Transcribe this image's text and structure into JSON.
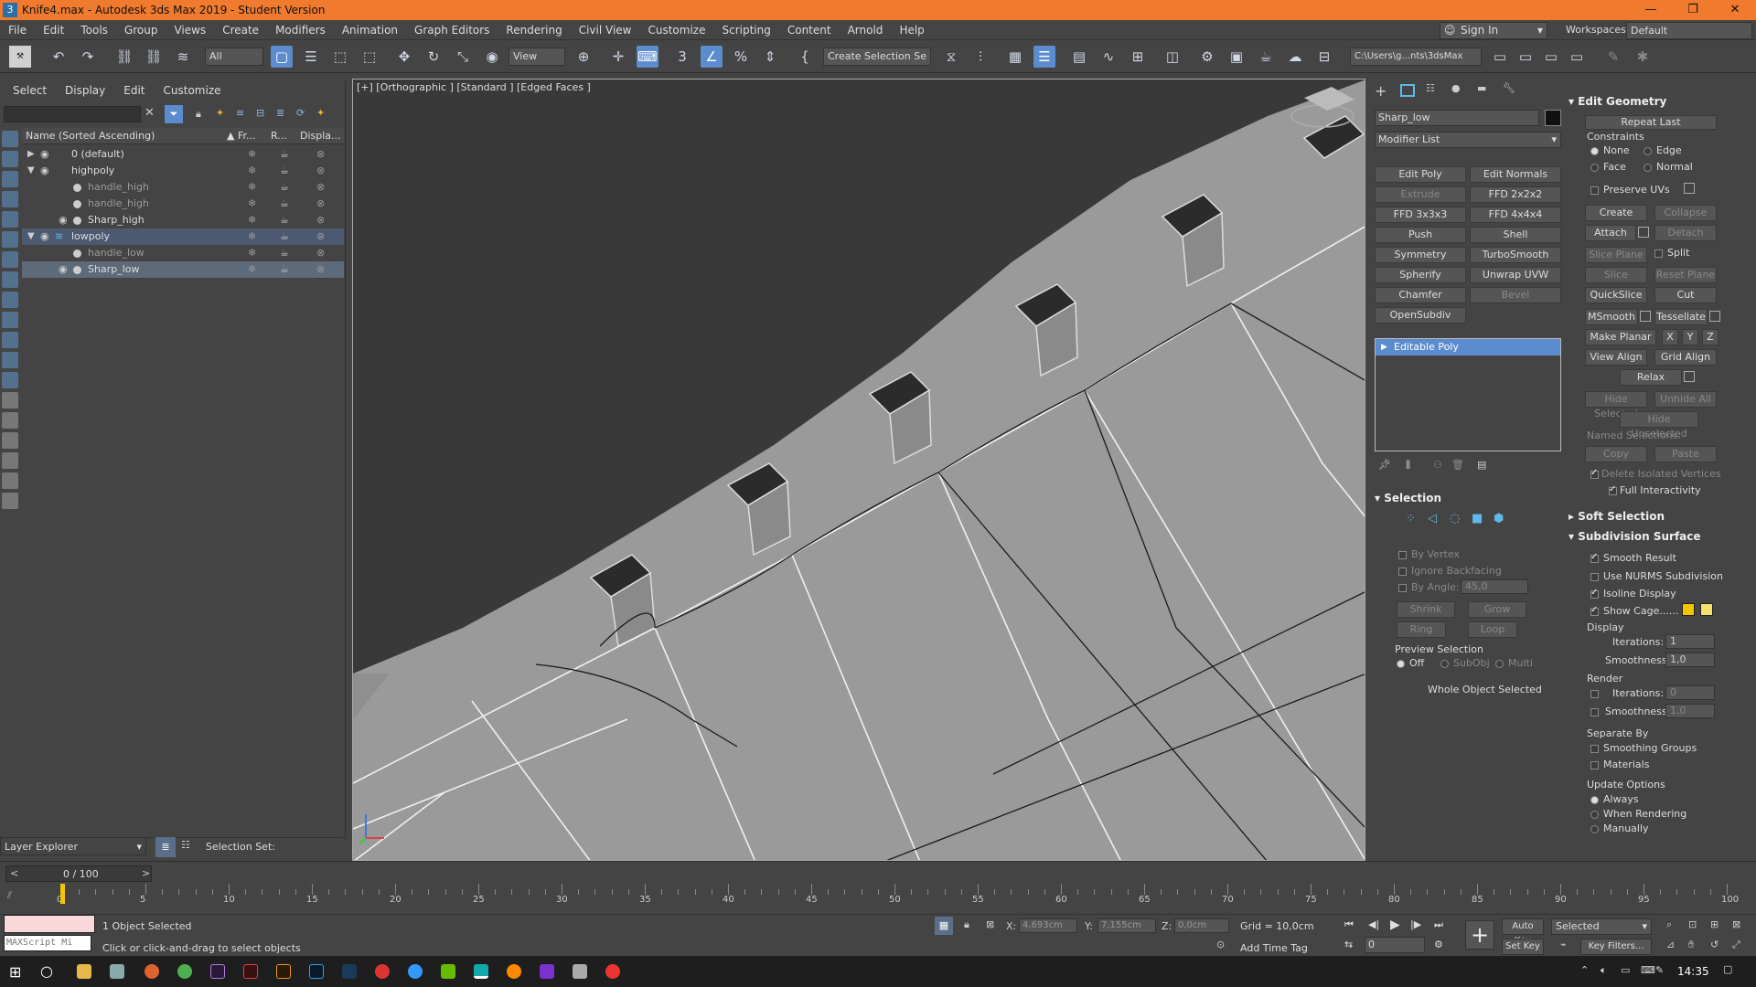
{
  "window": {
    "title": "Knife4.max - Autodesk 3ds Max 2019 - Student Version",
    "app_icon": "3"
  },
  "menu": [
    "File",
    "Edit",
    "Tools",
    "Group",
    "Views",
    "Create",
    "Modifiers",
    "Animation",
    "Graph Editors",
    "Rendering",
    "Civil View",
    "Customize",
    "Scripting",
    "Content",
    "Arnold",
    "Help"
  ],
  "toolbar": {
    "filter_select": "All",
    "ref_coord": "View",
    "selection_set": "Create Selection Se",
    "sign_in": "Sign In",
    "project_path": "C:\\Users\\g...nts\\3dsMax",
    "workspaces_label": "Workspaces:",
    "workspace_value": "Default"
  },
  "scene_explorer": {
    "tabs": [
      "Select",
      "Display",
      "Edit",
      "Customize"
    ],
    "col_name": "Name (Sorted Ascending)",
    "col_frozen": "Fr...",
    "col_render": "R...",
    "col_display": "Displa...",
    "rows": [
      {
        "name": "0 (default)",
        "level": 0
      },
      {
        "name": "highpoly",
        "level": 0
      },
      {
        "name": "handle_high",
        "level": 1
      },
      {
        "name": "handle_high",
        "level": 1
      },
      {
        "name": "Sharp_high",
        "level": 1
      },
      {
        "name": "lowpoly",
        "level": 0
      },
      {
        "name": "handle_low",
        "level": 1
      },
      {
        "name": "Sharp_low",
        "level": 1
      }
    ],
    "layer_explorer": "Layer Explorer",
    "selection_set_label": "Selection Set:"
  },
  "viewport": {
    "label": "[+] [Orthographic ] [Standard ] [Edged Faces ]"
  },
  "command_panel": {
    "object_name": "Sharp_low",
    "modifier_list": "Modifier List",
    "modifier_buttons": [
      "Edit Poly",
      "Edit Normals",
      "Extrude",
      "FFD 2x2x2",
      "FFD 3x3x3",
      "FFD 4x4x4",
      "Push",
      "Shell",
      "Symmetry",
      "TurboSmooth",
      "Spherify",
      "Unwrap UVW",
      "Chamfer",
      "Bevel",
      "OpenSubdiv"
    ],
    "stack_item": "Editable Poly",
    "selection": {
      "header": "Selection",
      "by_vertex": "By Vertex",
      "ignore_backfacing": "Ignore Backfacing",
      "by_angle": "By Angle:",
      "by_angle_value": "45,0",
      "shrink": "Shrink",
      "grow": "Grow",
      "ring": "Ring",
      "loop": "Loop",
      "preview": "Preview Selection",
      "off": "Off",
      "subobj": "SubObj",
      "multi": "Multi",
      "status": "Whole Object Selected"
    },
    "edit_geometry": {
      "header": "Edit Geometry",
      "repeat_last": "Repeat Last",
      "constraints": "Constraints",
      "none": "None",
      "edge": "Edge",
      "face": "Face",
      "normal": "Normal",
      "preserve_uvs": "Preserve UVs",
      "create": "Create",
      "collapse": "Collapse",
      "attach": "Attach",
      "detach": "Detach",
      "slice_plane": "Slice Plane",
      "split": "Split",
      "slice": "Slice",
      "reset_plane": "Reset Plane",
      "quickslice": "QuickSlice",
      "cut": "Cut",
      "msmooth": "MSmooth",
      "tessellate": "Tessellate",
      "make_planar": "Make Planar",
      "x": "X",
      "y": "Y",
      "z": "Z",
      "view_align": "View Align",
      "grid_align": "Grid Align",
      "relax": "Relax",
      "hide_selected": "Hide Selected",
      "unhide_all": "Unhide All",
      "hide_unselected": "Hide Unselected",
      "named_selections": "Named Selections:",
      "copy": "Copy",
      "paste": "Paste",
      "delete_isolated": "Delete Isolated Vertices",
      "full_interactivity": "Full Interactivity"
    },
    "soft_selection": "Soft Selection",
    "subdivision": {
      "header": "Subdivision Surface",
      "smooth_result": "Smooth Result",
      "use_nurms": "Use NURMS Subdivision",
      "isoline": "Isoline Display",
      "show_cage": "Show Cage......",
      "display": "Display",
      "iterations": "Iterations:",
      "iterations_value": "1",
      "smoothness": "Smoothness:",
      "smoothness_value": "1,0",
      "render": "Render",
      "r_iterations_value": "0",
      "r_smoothness_value": "1,0",
      "separate_by": "Separate By",
      "smoothing_groups": "Smoothing Groups",
      "materials": "Materials",
      "update_options": "Update Options",
      "always": "Always",
      "when_rendering": "When Rendering",
      "manually": "Manually"
    }
  },
  "timeline": {
    "frame": "0 / 100",
    "ticks": [
      "0",
      "5",
      "10",
      "15",
      "20",
      "25",
      "30",
      "35",
      "40",
      "45",
      "50",
      "55",
      "60",
      "65",
      "70",
      "75",
      "80",
      "85",
      "90",
      "95",
      "100"
    ]
  },
  "status": {
    "objects_selected": "1 Object Selected",
    "prompt": "Click or click-and-drag to select objects",
    "maxscript": "MAXScript Mi",
    "x_label": "X:",
    "x_value": "4,693cm",
    "y_label": "Y:",
    "y_value": "7,155cm",
    "z_label": "Z:",
    "z_value": "0,0cm",
    "grid": "Grid = 10,0cm",
    "add_time_tag": "Add Time Tag",
    "auto_key": "Auto Key",
    "set_key": "Set Key",
    "key_mode": "Selected",
    "key_filters": "Key Filters...",
    "frame_value": "0"
  },
  "taskbar": {
    "clock": "14:35"
  },
  "colors": {
    "title_bar": "#f07a2d",
    "selection_blue": "#5b8ccd",
    "cage_color_1": "#f5c400",
    "cage_color_2": "#f5e06a"
  }
}
